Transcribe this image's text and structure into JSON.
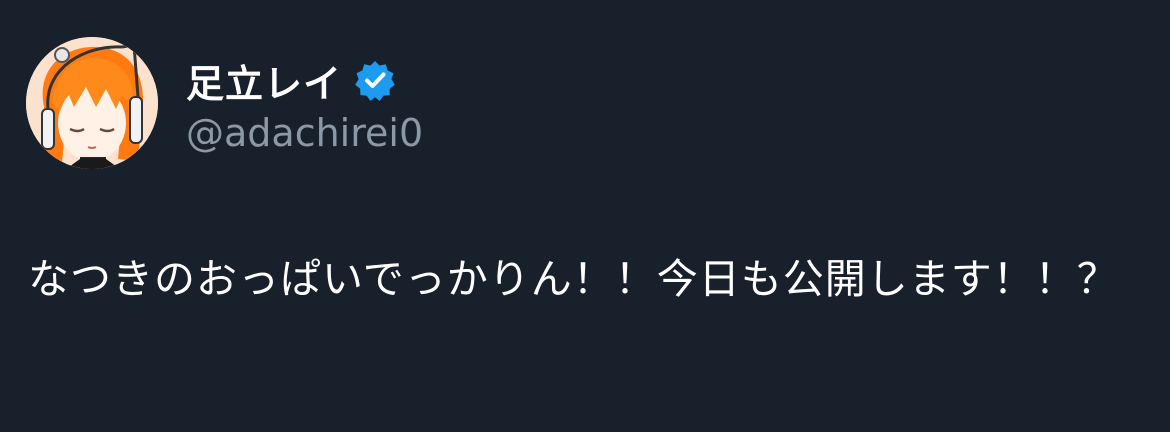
{
  "tweet": {
    "author": {
      "display_name": "足立レイ",
      "handle": "@adachirei0",
      "verified": true,
      "verified_color": "#1d9bf0",
      "avatar_icon": "avatar-icon"
    },
    "text": "なつきのおっぱいでっかりん！！今日も公開します！！？"
  },
  "colors": {
    "background": "#18202b",
    "name": "#ffffff",
    "handle": "#8b98a5",
    "text": "#ffffff"
  }
}
